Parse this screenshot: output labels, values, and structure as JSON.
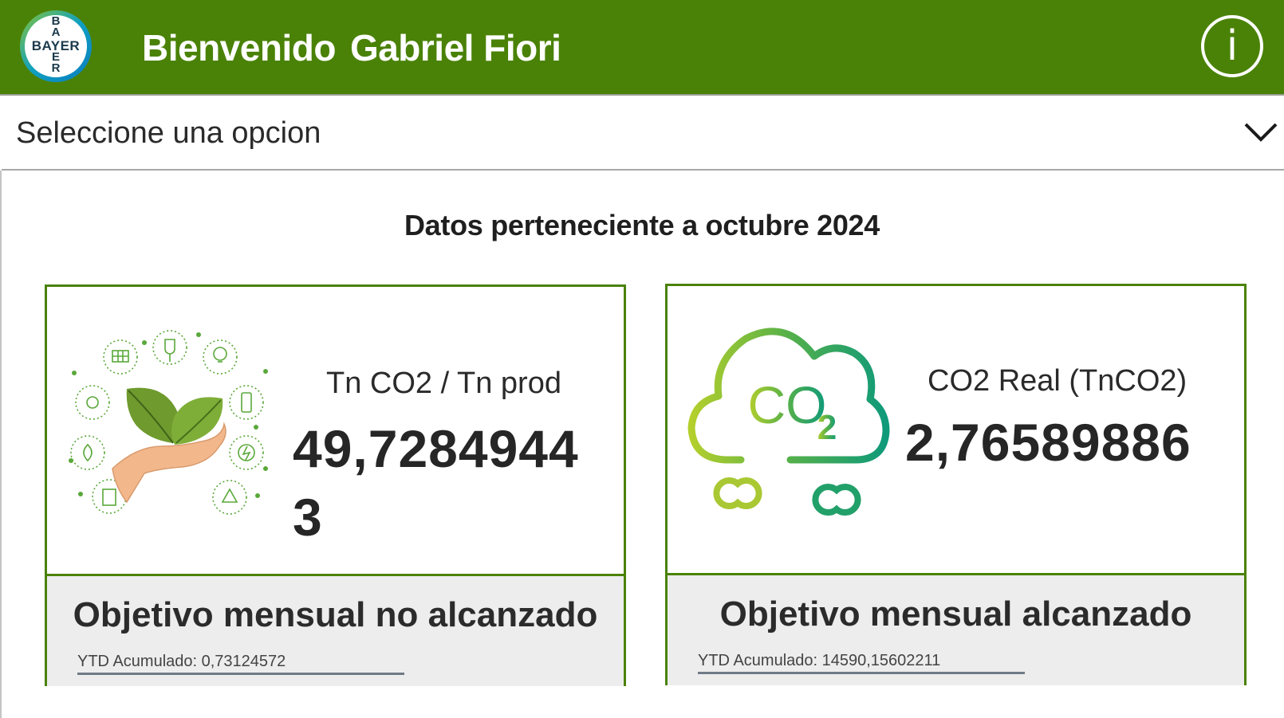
{
  "header": {
    "logo_text": "BAYER",
    "welcome": "Bienvenido",
    "user_name": "Gabriel Fiori",
    "info_symbol": "i",
    "brand_color": "#4a8207"
  },
  "selector": {
    "value": "Seleccione una opcion",
    "icon": "chevron-down-icon"
  },
  "period_title": "Datos perteneciente a octubre 2024",
  "cards": [
    {
      "label": "Tn CO2 / Tn prod",
      "value": "49,72849443",
      "status": "Objetivo mensual no alcanzado",
      "ytd": "YTD Acumulado: 0,73124572",
      "icon": "leaves-in-hand-icon"
    },
    {
      "label": "CO2 Real (TnCO2)",
      "value": "2,76589886",
      "status": "Objetivo mensual alcanzado",
      "ytd": "YTD Acumulado: 14590,15602211",
      "icon": "co2-cloud-icon",
      "icon_text": "CO",
      "icon_subscript": "2"
    }
  ]
}
